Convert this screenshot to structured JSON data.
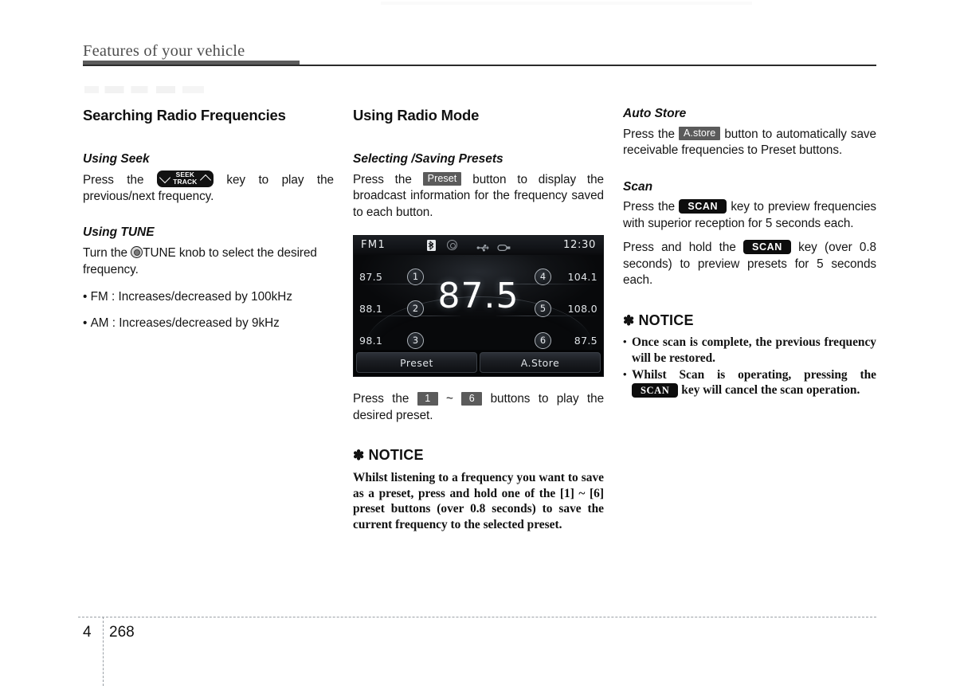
{
  "header": {
    "running_title": "Features of your vehicle"
  },
  "footer": {
    "chapter": "4",
    "page_number": "268"
  },
  "col1": {
    "section_title": "Searching Radio Frequencies",
    "seek": {
      "sub_title": "Using Seek",
      "text_before": "Press the",
      "key_line1": "SEEK",
      "key_line2": "TRACK",
      "text_after": "key to play the previous/next frequency."
    },
    "tune": {
      "sub_title": "Using TUNE",
      "text_before": "Turn the",
      "knob_label": "TUNE",
      "text_after": "knob to select the desired frequency.",
      "bullets": [
        "FM : Increases/decreased by 100kHz",
        "AM : Increases/decreased by 9kHz"
      ]
    }
  },
  "col2": {
    "section_title": "Using Radio Mode",
    "presets": {
      "sub_title": "Selecting /Saving Presets",
      "text_before": "Press the",
      "chip_label": "Preset",
      "text_after": "button to display the broadcast information for the frequency saved to each button."
    },
    "radio_display": {
      "band": "FM1",
      "time": "12:30",
      "status_icons": [
        "bluetooth-icon",
        "disc-icon",
        "usb-icon",
        "aux-icon"
      ],
      "big_frequency": "87.5",
      "presets_left": [
        {
          "frequency": "87.5",
          "number": "1"
        },
        {
          "frequency": "88.1",
          "number": "2"
        },
        {
          "frequency": "98.1",
          "number": "3"
        }
      ],
      "presets_right": [
        {
          "number": "4",
          "frequency": "104.1"
        },
        {
          "number": "5",
          "frequency": "108.0"
        },
        {
          "number": "6",
          "frequency": "87.5"
        }
      ],
      "button_preset": "Preset",
      "button_astore": "A.Store"
    },
    "play_preset": {
      "text_before": "Press the",
      "chip_from": "1",
      "tilde": "~",
      "chip_to": "6",
      "text_after": "buttons to play the desired preset."
    },
    "notice": {
      "heading": "NOTICE",
      "asterisk": "✽",
      "body": "Whilst listening to a frequency you want to save as a preset, press and hold one of the [1] ~ [6] preset buttons (over 0.8 seconds) to save the current frequency to the selected preset."
    }
  },
  "col3": {
    "auto_store": {
      "sub_title": "Auto Store",
      "text_before": "Press the",
      "chip_label": "A.store",
      "text_after": "button to automatically save receivable frequencies to Preset buttons."
    },
    "scan": {
      "sub_title": "Scan",
      "para1_before": "Press the",
      "chip_label": "SCAN",
      "para1_after": "key to preview frequencies with superior reception for 5 seconds each.",
      "para2_before": "Press and hold the",
      "para2_after": "key (over 0.8 seconds) to preview presets for 5 seconds each."
    },
    "notice": {
      "heading": "NOTICE",
      "asterisk": "✽",
      "bullet1": "Once scan is complete, the previous frequency will be restored.",
      "bullet2_before": "Whilst Scan is operating, pressing the",
      "bullet2_chip": "SCAN",
      "bullet2_after": "key will cancel the scan operation."
    }
  }
}
